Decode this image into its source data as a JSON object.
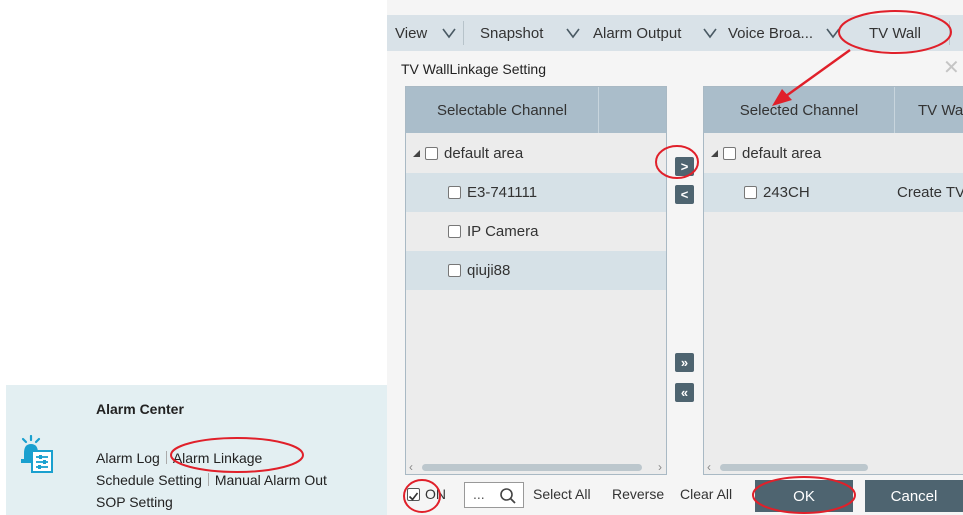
{
  "alarm_center": {
    "title": "Alarm Center",
    "links": [
      "Alarm Log",
      "Alarm Linkage",
      "Schedule Setting",
      "Manual Alarm Out",
      "SOP Setting"
    ]
  },
  "toolbar": {
    "items": [
      "View",
      "Snapshot",
      "Alarm Output",
      "Voice Broa...",
      "TV Wall"
    ]
  },
  "dialog": {
    "title": "TV WallLinkage Setting",
    "close": "✕",
    "left_list": {
      "header": "Selectable Channel",
      "rows": [
        "default area",
        "E3-741111",
        "IP Camera",
        "qiuji88"
      ]
    },
    "right_list": {
      "headers": [
        "Selected Channel",
        "TV Wa"
      ],
      "rows": [
        {
          "name": "default area",
          "tv_wall": ""
        },
        {
          "name": "243CH",
          "tv_wall": "Create TV"
        }
      ]
    },
    "move_buttons": {
      "add": ">",
      "remove": "<",
      "add_all": "»",
      "remove_all": "«"
    },
    "footer": {
      "on_label": "ON",
      "search_dots": "...",
      "select_all": "Select All",
      "reverse": "Reverse",
      "clear_all": "Clear All",
      "ok": "OK",
      "cancel": "Cancel"
    }
  },
  "colors": {
    "toolbar_bg": "#d9e2e8",
    "header_bg": "#aabdca",
    "alt_row": "#d6e1e7",
    "panel_bg": "#ececec",
    "button_bg": "#4e6470",
    "annotation": "#e0202a",
    "alarm_icon": "#1aa0cf"
  }
}
